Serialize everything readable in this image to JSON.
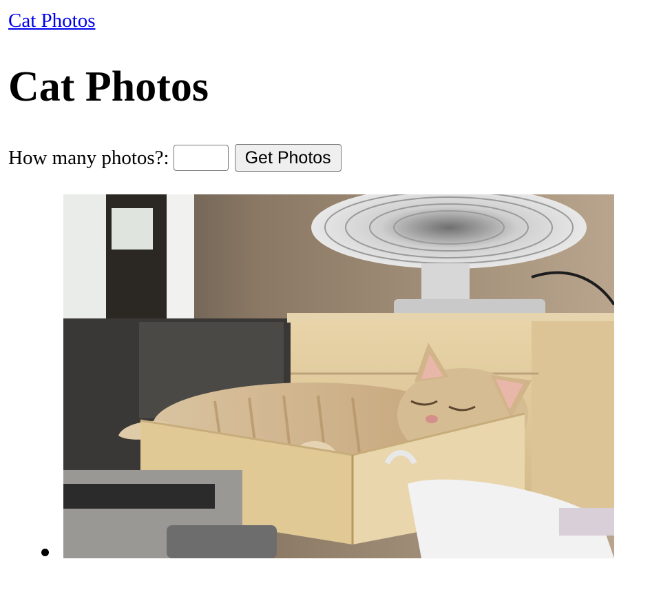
{
  "header": {
    "link_label": "Cat Photos",
    "title": "Cat Photos"
  },
  "form": {
    "label": "How many photos?:",
    "input_value": "",
    "input_placeholder": "",
    "button_label": "Get Photos"
  },
  "photos": [
    {
      "subject": "orange tabby kitten sleeping in an open wooden drawer"
    }
  ]
}
